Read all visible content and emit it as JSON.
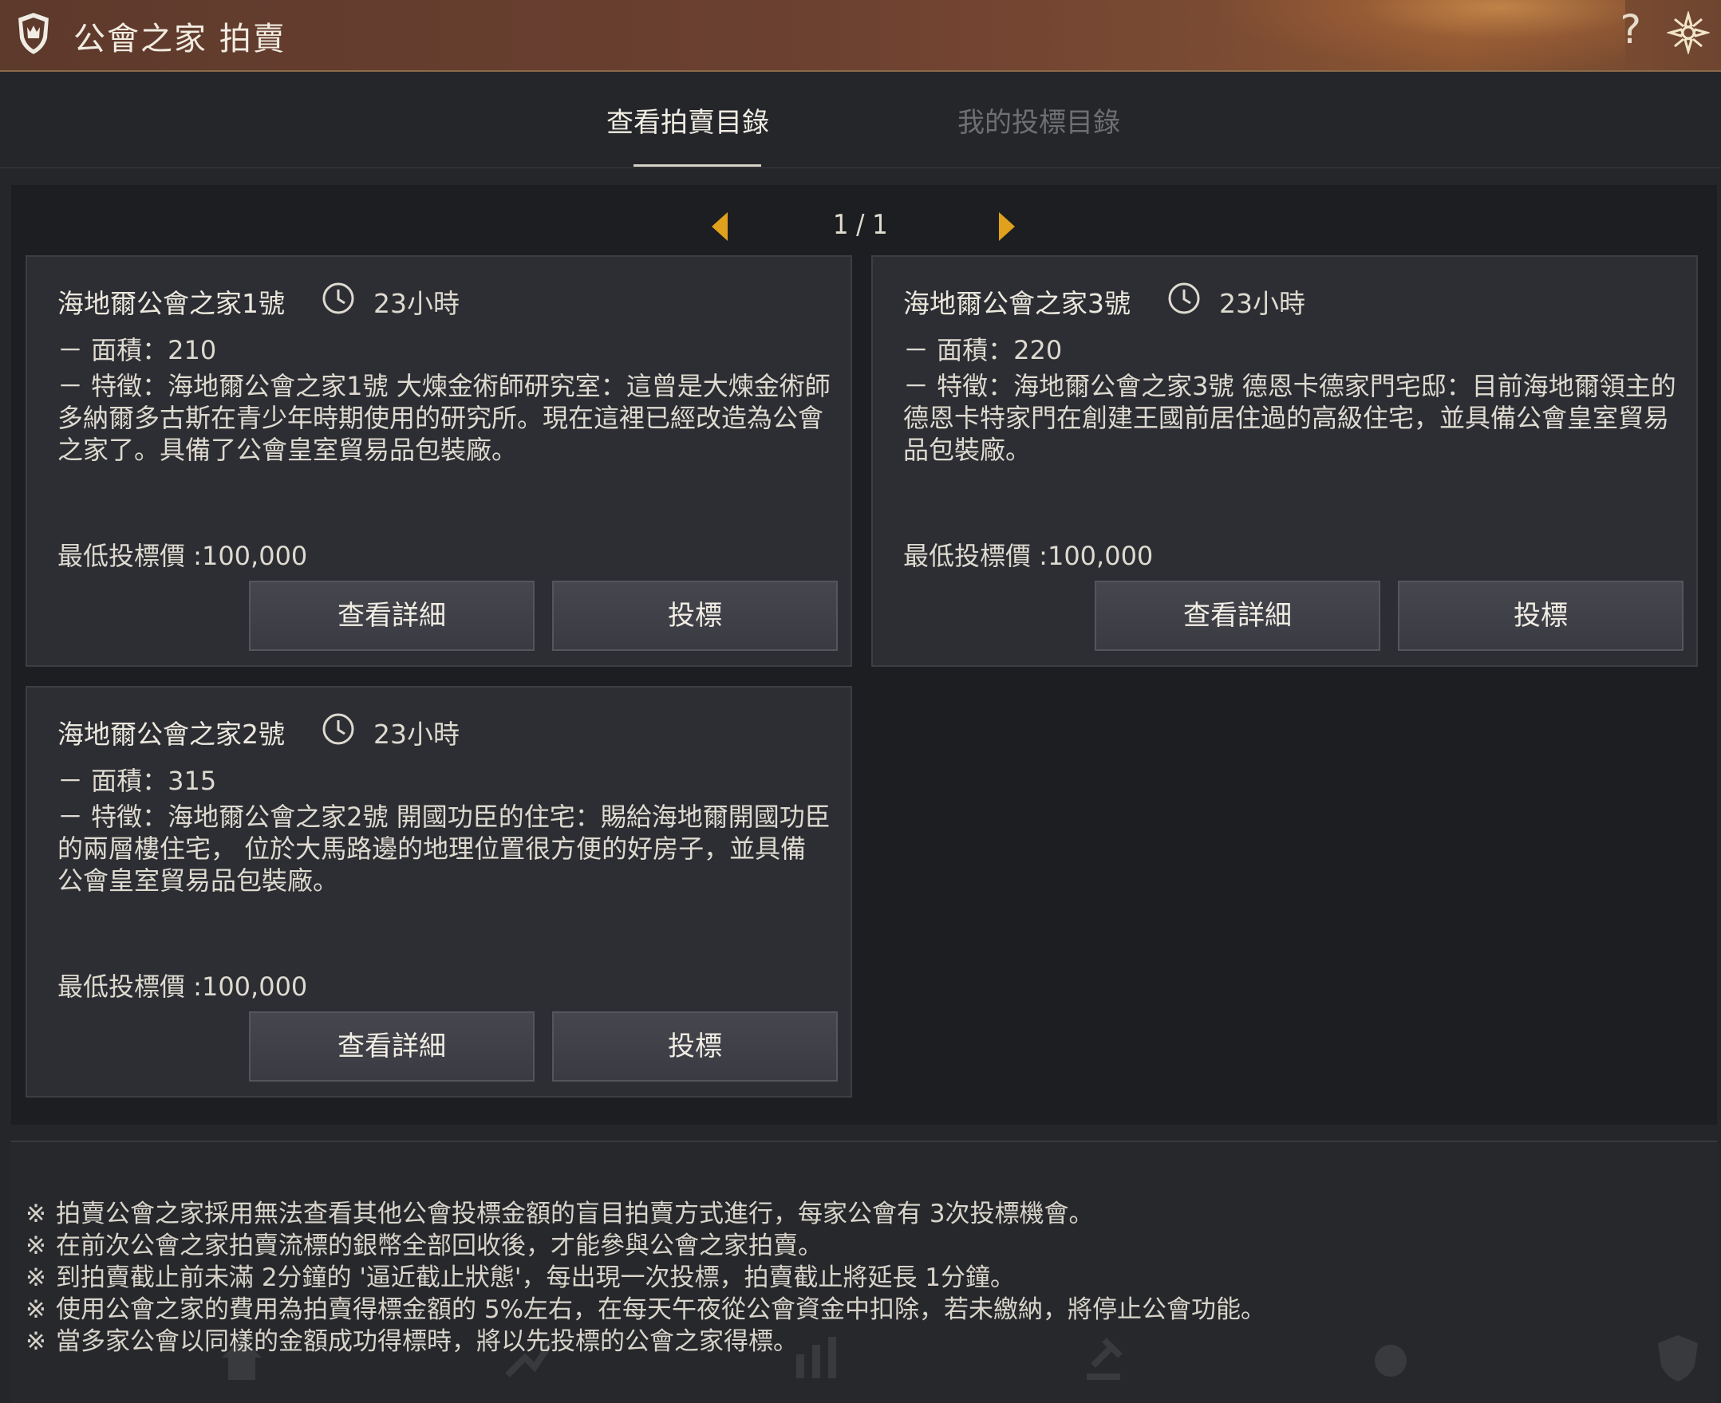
{
  "header": {
    "title": "公會之家 拍賣",
    "help_label": "?"
  },
  "tabs": [
    {
      "label": "查看拍賣目錄",
      "active": true
    },
    {
      "label": "我的投標目錄",
      "active": false
    }
  ],
  "pager": {
    "text": "1 / 1"
  },
  "listings": [
    {
      "name": "海地爾公會之家1號",
      "time_left": "23小時",
      "area": "－ 面積：210",
      "description": "－ 特徵：海地爾公會之家1號 大煉金術師研究室：這曾是大煉金術師多納爾多古斯在青少年時期使用的研究所。現在這裡已經改造為公會之家了。具備了公會皇室貿易品包裝廠。",
      "min_bid": "最低投標價 :100,000",
      "detail_label": "查看詳細",
      "bid_label": "投標"
    },
    {
      "name": "海地爾公會之家3號",
      "time_left": "23小時",
      "area": "－ 面積：220",
      "description": "－ 特徵：海地爾公會之家3號 德恩卡德家門宅邸：目前海地爾領主的德恩卡特家門在創建王國前居住過的高級住宅，並具備公會皇室貿易品包裝廠。",
      "min_bid": "最低投標價 :100,000",
      "detail_label": "查看詳細",
      "bid_label": "投標"
    },
    {
      "name": "海地爾公會之家2號",
      "time_left": "23小時",
      "area": "－ 面積：315",
      "description": "－ 特徵：海地爾公會之家2號 開國功臣的住宅：賜給海地爾開國功臣的兩層樓住宅， 位於大馬路邊的地理位置很方便的好房子，並具備公會皇室貿易品包裝廠。",
      "min_bid": "最低投標價 :100,000",
      "detail_label": "查看詳細",
      "bid_label": "投標"
    }
  ],
  "notes": [
    "拍賣公會之家採用無法查看其他公會投標金額的盲目拍賣方式進行，每家公會有 3次投標機會。",
    "在前次公會之家拍賣流標的銀幣全部回收後，才能參與公會之家拍賣。",
    "到拍賣截止前未滿 2分鐘的 '逼近截止狀態'，每出現一次投標，拍賣截止將延長 1分鐘。",
    "使用公會之家的費用為拍賣得標金額的 5%左右，在每天午夜從公會資金中扣除，若未繳納，將停止公會功能。",
    "當多家公會以同樣的金額成功得標時，將以先投標的公會之家得標。"
  ],
  "note_mark": "※",
  "colors": {
    "accent": "#e0a11c",
    "header": "#6b4030"
  }
}
